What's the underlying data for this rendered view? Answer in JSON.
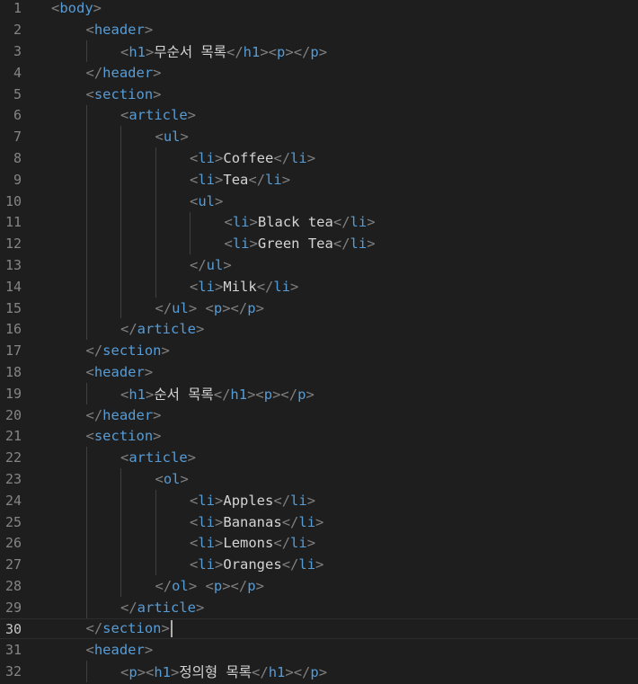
{
  "editor": {
    "active_line": 30,
    "lines": [
      {
        "n": "1",
        "indent": 0,
        "parts": [
          [
            "br",
            "<"
          ],
          [
            "tag",
            "body"
          ],
          [
            "br",
            ">"
          ]
        ]
      },
      {
        "n": "2",
        "indent": 1,
        "parts": [
          [
            "br",
            "<"
          ],
          [
            "tag",
            "header"
          ],
          [
            "br",
            ">"
          ]
        ]
      },
      {
        "n": "3",
        "indent": 2,
        "parts": [
          [
            "br",
            "<"
          ],
          [
            "tag",
            "h1"
          ],
          [
            "br",
            ">"
          ],
          [
            "txt",
            "무순서 목록"
          ],
          [
            "br",
            "</"
          ],
          [
            "tag",
            "h1"
          ],
          [
            "br",
            "><"
          ],
          [
            "tag",
            "p"
          ],
          [
            "br",
            "></"
          ],
          [
            "tag",
            "p"
          ],
          [
            "br",
            ">"
          ]
        ]
      },
      {
        "n": "4",
        "indent": 1,
        "parts": [
          [
            "br",
            "</"
          ],
          [
            "tag",
            "header"
          ],
          [
            "br",
            ">"
          ]
        ]
      },
      {
        "n": "5",
        "indent": 1,
        "parts": [
          [
            "br",
            "<"
          ],
          [
            "tag",
            "section"
          ],
          [
            "br",
            ">"
          ]
        ]
      },
      {
        "n": "6",
        "indent": 2,
        "parts": [
          [
            "br",
            "<"
          ],
          [
            "tag",
            "article"
          ],
          [
            "br",
            ">"
          ]
        ]
      },
      {
        "n": "7",
        "indent": 3,
        "parts": [
          [
            "br",
            "<"
          ],
          [
            "tag",
            "ul"
          ],
          [
            "br",
            ">"
          ]
        ]
      },
      {
        "n": "8",
        "indent": 4,
        "parts": [
          [
            "br",
            "<"
          ],
          [
            "tag",
            "li"
          ],
          [
            "br",
            ">"
          ],
          [
            "txt",
            "Coffee"
          ],
          [
            "br",
            "</"
          ],
          [
            "tag",
            "li"
          ],
          [
            "br",
            ">"
          ]
        ]
      },
      {
        "n": "9",
        "indent": 4,
        "parts": [
          [
            "br",
            "<"
          ],
          [
            "tag",
            "li"
          ],
          [
            "br",
            ">"
          ],
          [
            "txt",
            "Tea"
          ],
          [
            "br",
            "</"
          ],
          [
            "tag",
            "li"
          ],
          [
            "br",
            ">"
          ]
        ]
      },
      {
        "n": "10",
        "indent": 4,
        "parts": [
          [
            "br",
            "<"
          ],
          [
            "tag",
            "ul"
          ],
          [
            "br",
            ">"
          ]
        ]
      },
      {
        "n": "11",
        "indent": 5,
        "parts": [
          [
            "br",
            "<"
          ],
          [
            "tag",
            "li"
          ],
          [
            "br",
            ">"
          ],
          [
            "txt",
            "Black tea"
          ],
          [
            "br",
            "</"
          ],
          [
            "tag",
            "li"
          ],
          [
            "br",
            ">"
          ]
        ]
      },
      {
        "n": "12",
        "indent": 5,
        "parts": [
          [
            "br",
            "<"
          ],
          [
            "tag",
            "li"
          ],
          [
            "br",
            ">"
          ],
          [
            "txt",
            "Green Tea"
          ],
          [
            "br",
            "</"
          ],
          [
            "tag",
            "li"
          ],
          [
            "br",
            ">"
          ]
        ]
      },
      {
        "n": "13",
        "indent": 4,
        "parts": [
          [
            "br",
            "</"
          ],
          [
            "tag",
            "ul"
          ],
          [
            "br",
            ">"
          ]
        ]
      },
      {
        "n": "14",
        "indent": 4,
        "parts": [
          [
            "br",
            "<"
          ],
          [
            "tag",
            "li"
          ],
          [
            "br",
            ">"
          ],
          [
            "txt",
            "Milk"
          ],
          [
            "br",
            "</"
          ],
          [
            "tag",
            "li"
          ],
          [
            "br",
            ">"
          ]
        ]
      },
      {
        "n": "15",
        "indent": 3,
        "parts": [
          [
            "br",
            "</"
          ],
          [
            "tag",
            "ul"
          ],
          [
            "br",
            ">"
          ],
          [
            "txt",
            " "
          ],
          [
            "br",
            "<"
          ],
          [
            "tag",
            "p"
          ],
          [
            "br",
            "></"
          ],
          [
            "tag",
            "p"
          ],
          [
            "br",
            ">"
          ]
        ]
      },
      {
        "n": "16",
        "indent": 2,
        "parts": [
          [
            "br",
            "</"
          ],
          [
            "tag",
            "article"
          ],
          [
            "br",
            ">"
          ]
        ]
      },
      {
        "n": "17",
        "indent": 1,
        "parts": [
          [
            "br",
            "</"
          ],
          [
            "tag",
            "section"
          ],
          [
            "br",
            ">"
          ]
        ]
      },
      {
        "n": "18",
        "indent": 1,
        "parts": [
          [
            "br",
            "<"
          ],
          [
            "tag",
            "header"
          ],
          [
            "br",
            ">"
          ]
        ]
      },
      {
        "n": "19",
        "indent": 2,
        "parts": [
          [
            "br",
            "<"
          ],
          [
            "tag",
            "h1"
          ],
          [
            "br",
            ">"
          ],
          [
            "txt",
            "순서 목록"
          ],
          [
            "br",
            "</"
          ],
          [
            "tag",
            "h1"
          ],
          [
            "br",
            "><"
          ],
          [
            "tag",
            "p"
          ],
          [
            "br",
            "></"
          ],
          [
            "tag",
            "p"
          ],
          [
            "br",
            ">"
          ]
        ]
      },
      {
        "n": "20",
        "indent": 1,
        "parts": [
          [
            "br",
            "</"
          ],
          [
            "tag",
            "header"
          ],
          [
            "br",
            ">"
          ]
        ]
      },
      {
        "n": "21",
        "indent": 1,
        "parts": [
          [
            "br",
            "<"
          ],
          [
            "tag",
            "section"
          ],
          [
            "br",
            ">"
          ]
        ]
      },
      {
        "n": "22",
        "indent": 2,
        "parts": [
          [
            "br",
            "<"
          ],
          [
            "tag",
            "article"
          ],
          [
            "br",
            ">"
          ]
        ]
      },
      {
        "n": "23",
        "indent": 3,
        "parts": [
          [
            "br",
            "<"
          ],
          [
            "tag",
            "ol"
          ],
          [
            "br",
            ">"
          ]
        ]
      },
      {
        "n": "24",
        "indent": 4,
        "parts": [
          [
            "br",
            "<"
          ],
          [
            "tag",
            "li"
          ],
          [
            "br",
            ">"
          ],
          [
            "txt",
            "Apples"
          ],
          [
            "br",
            "</"
          ],
          [
            "tag",
            "li"
          ],
          [
            "br",
            ">"
          ]
        ]
      },
      {
        "n": "25",
        "indent": 4,
        "parts": [
          [
            "br",
            "<"
          ],
          [
            "tag",
            "li"
          ],
          [
            "br",
            ">"
          ],
          [
            "txt",
            "Bananas"
          ],
          [
            "br",
            "</"
          ],
          [
            "tag",
            "li"
          ],
          [
            "br",
            ">"
          ]
        ]
      },
      {
        "n": "26",
        "indent": 4,
        "parts": [
          [
            "br",
            "<"
          ],
          [
            "tag",
            "li"
          ],
          [
            "br",
            ">"
          ],
          [
            "txt",
            "Lemons"
          ],
          [
            "br",
            "</"
          ],
          [
            "tag",
            "li"
          ],
          [
            "br",
            ">"
          ]
        ]
      },
      {
        "n": "27",
        "indent": 4,
        "parts": [
          [
            "br",
            "<"
          ],
          [
            "tag",
            "li"
          ],
          [
            "br",
            ">"
          ],
          [
            "txt",
            "Oranges"
          ],
          [
            "br",
            "</"
          ],
          [
            "tag",
            "li"
          ],
          [
            "br",
            ">"
          ]
        ]
      },
      {
        "n": "28",
        "indent": 3,
        "parts": [
          [
            "br",
            "</"
          ],
          [
            "tag",
            "ol"
          ],
          [
            "br",
            ">"
          ],
          [
            "txt",
            " "
          ],
          [
            "br",
            "<"
          ],
          [
            "tag",
            "p"
          ],
          [
            "br",
            "></"
          ],
          [
            "tag",
            "p"
          ],
          [
            "br",
            ">"
          ]
        ]
      },
      {
        "n": "29",
        "indent": 2,
        "parts": [
          [
            "br",
            "</"
          ],
          [
            "tag",
            "article"
          ],
          [
            "br",
            ">"
          ]
        ]
      },
      {
        "n": "30",
        "indent": 1,
        "parts": [
          [
            "br",
            "</"
          ],
          [
            "tag",
            "section"
          ],
          [
            "br",
            ">"
          ]
        ]
      },
      {
        "n": "31",
        "indent": 1,
        "parts": [
          [
            "br",
            "<"
          ],
          [
            "tag",
            "header"
          ],
          [
            "br",
            ">"
          ]
        ]
      },
      {
        "n": "32",
        "indent": 2,
        "parts": [
          [
            "br",
            "<"
          ],
          [
            "tag",
            "p"
          ],
          [
            "br",
            "><"
          ],
          [
            "tag",
            "h1"
          ],
          [
            "br",
            ">"
          ],
          [
            "txt",
            "정의형 목록"
          ],
          [
            "br",
            "</"
          ],
          [
            "tag",
            "h1"
          ],
          [
            "br",
            "></"
          ],
          [
            "tag",
            "p"
          ],
          [
            "br",
            ">"
          ]
        ]
      }
    ]
  }
}
